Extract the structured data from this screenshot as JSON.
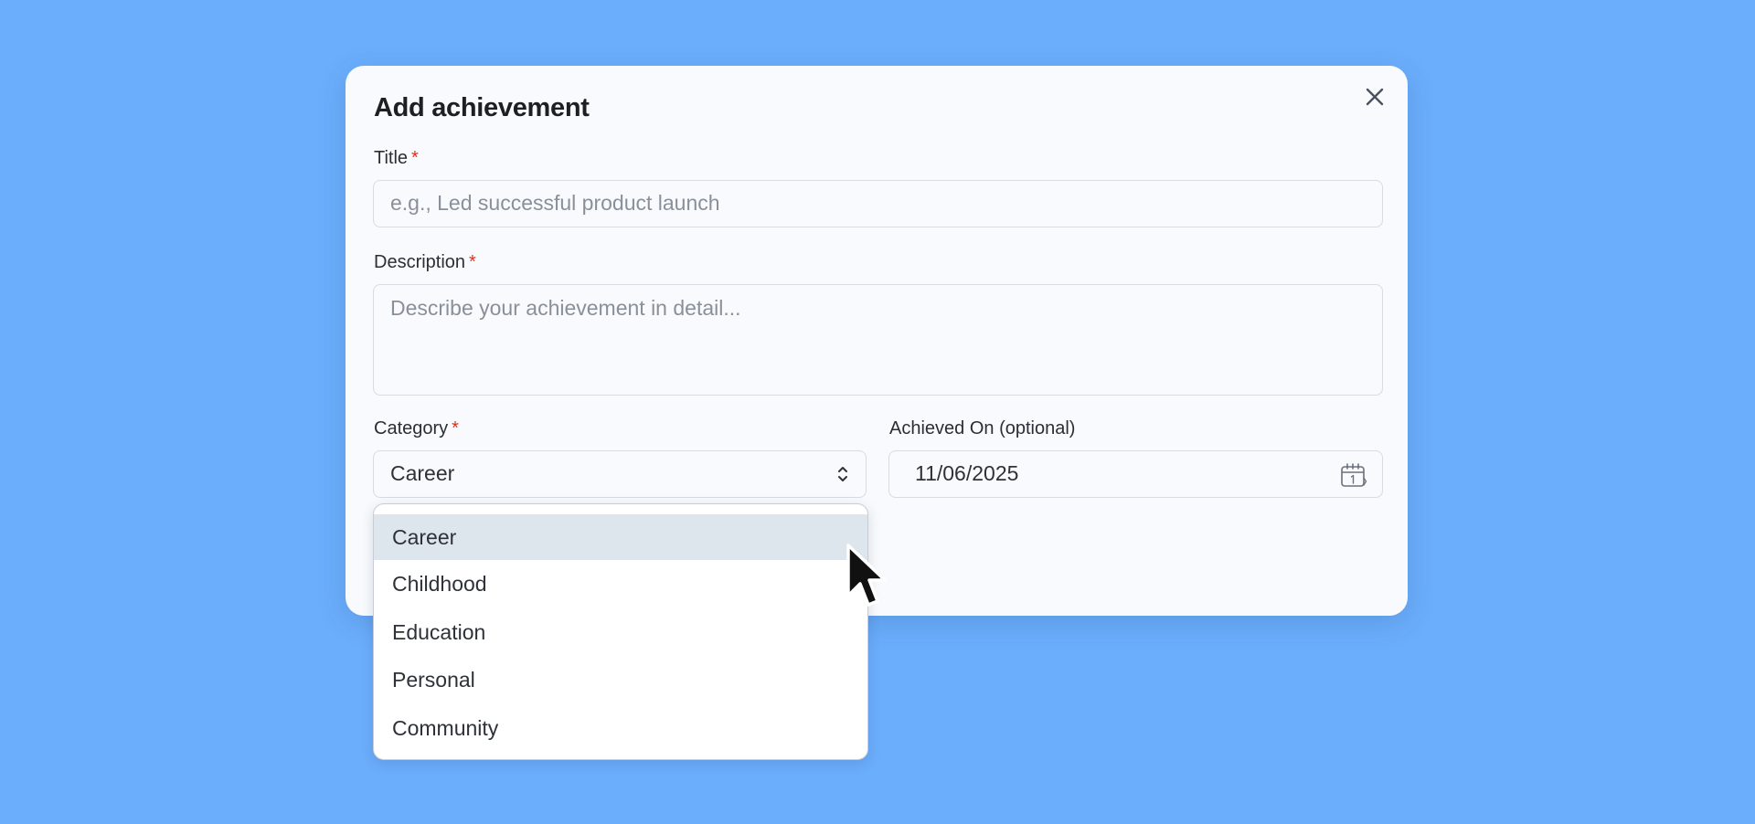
{
  "dialog": {
    "title": "Add achievement",
    "close_icon": "close-icon"
  },
  "form": {
    "title_field": {
      "label": "Title",
      "required_mark": "*",
      "value": "",
      "placeholder": "e.g., Led successful product launch"
    },
    "description_field": {
      "label": "Description",
      "required_mark": "*",
      "value": "",
      "placeholder": "Describe your achievement in detail..."
    },
    "category_field": {
      "label": "Category",
      "required_mark": "*",
      "value": "Career",
      "icon": "chevron-up-down-icon",
      "dropdown_open": true,
      "options": [
        "Career",
        "Childhood",
        "Education",
        "Personal",
        "Community"
      ],
      "highlighted_option": "Career"
    },
    "date_field": {
      "label": "Achieved On (optional)",
      "value": "11/06/2025",
      "icon": "calendar-icon"
    }
  },
  "colors": {
    "background": "#6baefc",
    "dialog_background": "#f8fafd",
    "required_mark": "#e0301e",
    "highlighted_option": "#dde6ec"
  }
}
